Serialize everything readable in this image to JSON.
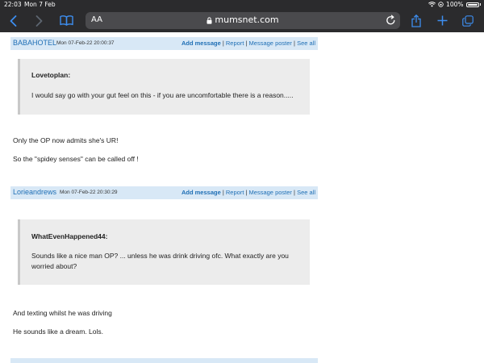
{
  "status": {
    "time": "22:03",
    "date": "Mon 7 Feb",
    "battery": "100%"
  },
  "browser": {
    "text_size_label": "AA",
    "url": "mumsnet.com",
    "icons": [
      "back-icon",
      "forward-icon",
      "bookmarks-icon",
      "lock-icon",
      "reload-icon",
      "share-icon",
      "new-tab-icon",
      "tabs-icon"
    ]
  },
  "posts": [
    {
      "user": "BABAHOTEL",
      "date": "Mon 07-Feb-22 20:00:37",
      "actions": {
        "add": "Add message",
        "report": "Report",
        "poster": "Message poster",
        "see_all": "See all"
      },
      "quote": {
        "name": "Lovetoplan:",
        "text": "I would say go with your gut feel on this - if you are uncomfortable there is a reason....."
      },
      "lines": [
        "Only the OP now admits she's UR!",
        "So the \"spidey senses\" can be called off !"
      ]
    },
    {
      "user": "Lorieandrews",
      "date": "Mon 07-Feb-22 20:30:29",
      "actions": {
        "add": "Add message",
        "report": "Report",
        "poster": "Message poster",
        "see_all": "See all"
      },
      "quote": {
        "name": "WhatEvenHappened44:",
        "text": "Sounds like a nice man OP? ... unless he was drink driving ofc. What exactly are you worried about?"
      },
      "lines": [
        "And texting whilst he was driving",
        "He sounds like a dream. Lols."
      ]
    }
  ],
  "colors": {
    "toolbar": "#2b2b2d",
    "header_bg": "#d8e8f6",
    "link": "#1f6fb5",
    "quote_bg": "#ececec"
  }
}
